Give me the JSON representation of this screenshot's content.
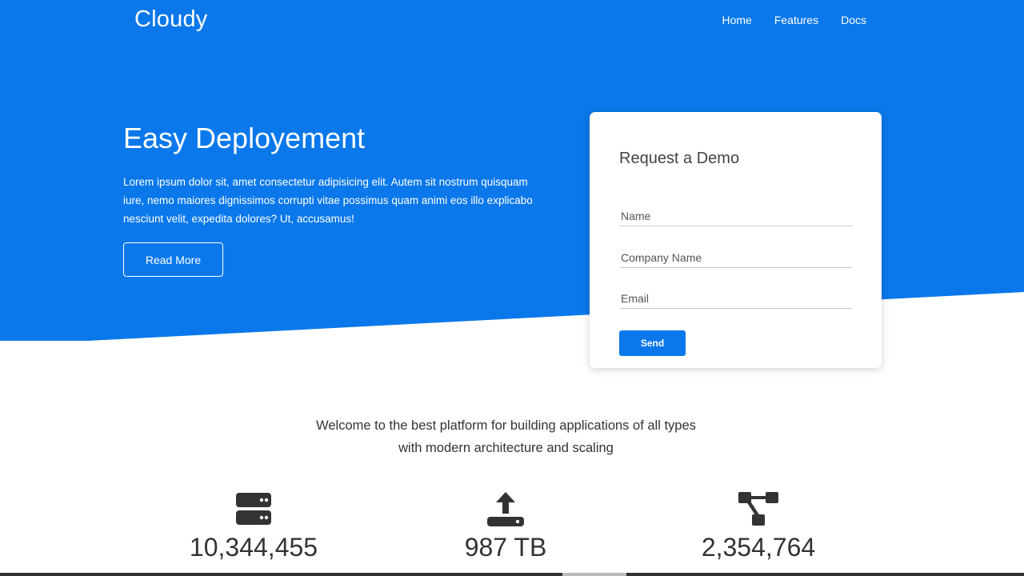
{
  "navbar": {
    "brand": "Cloudy",
    "links": [
      "Home",
      "Features",
      "Docs"
    ]
  },
  "hero": {
    "title": "Easy Deployement",
    "text": "Lorem ipsum dolor sit, amet consectetur adipisicing elit. Autem sit nostrum quisquam iure, nemo maiores dignissimos corrupti vitae possimus quam animi eos illo explicabo nesciunt velit, expedita dolores? Ut, accusamus!",
    "button_label": "Read More"
  },
  "demo_form": {
    "title": "Request a Demo",
    "name_placeholder": "Name",
    "company_placeholder": "Company Name",
    "email_placeholder": "Email",
    "send_label": "Send"
  },
  "welcome_text": "Welcome to the best platform for building applications of all types with modern architecture and scaling",
  "stats": [
    {
      "icon": "server-icon",
      "value": "10,344,455"
    },
    {
      "icon": "upload-icon",
      "value": "987 TB"
    },
    {
      "icon": "network-icon",
      "value": "2,354,764"
    }
  ],
  "colors": {
    "primary": "#0a78ea",
    "text": "#333333"
  }
}
